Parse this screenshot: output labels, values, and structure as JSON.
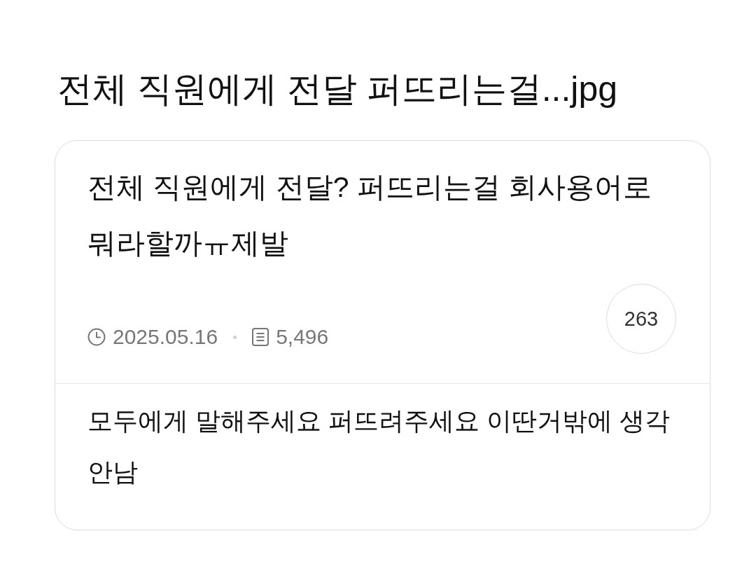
{
  "post_title": "전체 직원에게 전달 퍼뜨리는걸...jpg",
  "question": {
    "text": "전체 직원에게 전달? 퍼뜨리는걸 회사용어로 뭐라할까ㅠ제발",
    "date": "2025.05.16",
    "views": "5,496",
    "answer_count": "263"
  },
  "answer": {
    "text": "모두에게 말해주세요 퍼뜨려주세요 이딴거밖에 생각 안남"
  }
}
